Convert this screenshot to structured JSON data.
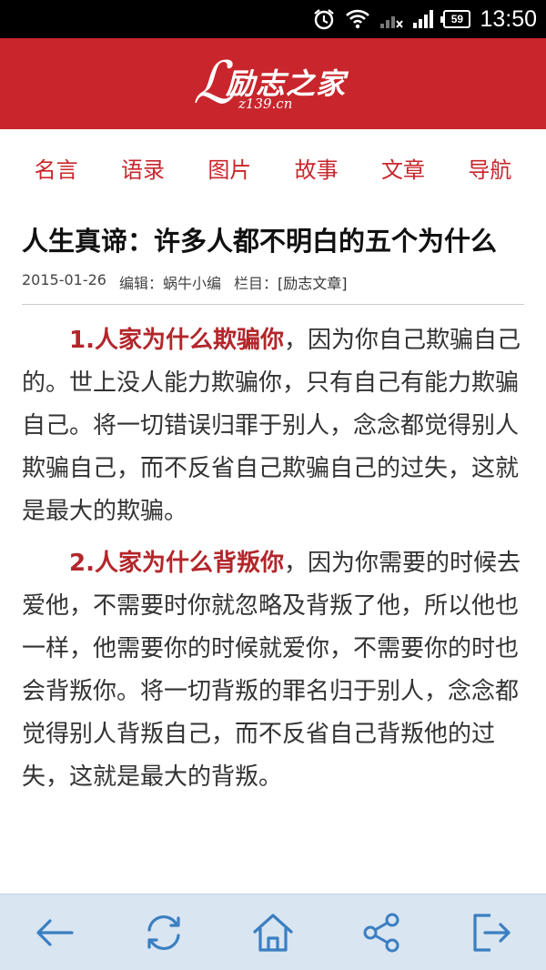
{
  "status_bar": {
    "time": "13:50",
    "battery": "59"
  },
  "header": {
    "logo_name": "励志之家",
    "logo_domain": "z139.cn"
  },
  "nav": [
    {
      "label": "名言"
    },
    {
      "label": "语录"
    },
    {
      "label": "图片"
    },
    {
      "label": "故事"
    },
    {
      "label": "文章"
    },
    {
      "label": "导航"
    }
  ],
  "article": {
    "title": "人生真谛：许多人都不明白的五个为什么",
    "date": "2015-01-26",
    "editor": "编辑：蜗牛小编",
    "category_label": "栏目：",
    "category": "[励志文章]",
    "paragraphs": [
      {
        "heading": "1.人家为什么欺骗你",
        "text": "，因为你自己欺骗自己的。世上没人能力欺骗你，只有自己有能力欺骗自己。将一切错误归罪于别人，念念都觉得别人欺骗自己，而不反省自己欺骗自己的过失，这就是最大的欺骗。"
      },
      {
        "heading": "2.人家为什么背叛你",
        "text": "，因为你需要的时候去爱他，不需要时你就忽略及背叛了他，所以他也一样，他需要你的时候就爱你，不需要你的时也会背叛你。将一切背叛的罪名归于别人，念念都觉得别人背叛自己，而不反省自己背叛他的过失，这就是最大的背叛。"
      }
    ]
  },
  "toolbar": {
    "buttons": [
      {
        "icon": "back-arrow-icon"
      },
      {
        "icon": "refresh-icon"
      },
      {
        "icon": "home-icon"
      },
      {
        "icon": "share-icon"
      },
      {
        "icon": "exit-icon"
      }
    ]
  },
  "colors": {
    "brand_red": "#c8262c",
    "toolbar_blue": "#3a7fc1"
  }
}
